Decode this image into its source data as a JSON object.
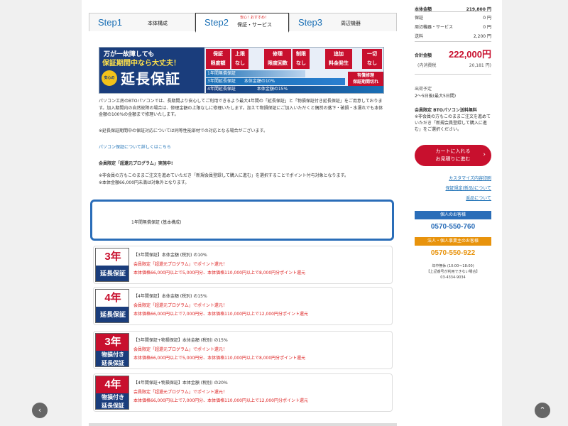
{
  "tabs": [
    {
      "num": "Step1",
      "name": "本体構成"
    },
    {
      "num": "Step2",
      "name": "保証・サービス",
      "sub": "安心！おすすめ！"
    },
    {
      "num": "Step3",
      "name": "周辺機器"
    }
  ],
  "banner": {
    "line1": "万が一故障しても",
    "line2": "保証期間中なら大丈夫！",
    "safe": "安心の",
    "main": "延長保証",
    "badges": [
      {
        "t1": "保証",
        "t2": "限度額"
      },
      {
        "t1": "上限",
        "t2": "なし"
      },
      {
        "t1": "修理",
        "t2": "限度回数"
      },
      {
        "t1": "制限",
        "t2": "なし"
      },
      {
        "t1": "追加",
        "t2": "料金発生"
      },
      {
        "t1": "一切",
        "t2": "なし"
      }
    ],
    "bars": [
      {
        "label": "1年間",
        "tag": "無償保証",
        "pct": ""
      },
      {
        "label": "3年間",
        "tag": "延長保証",
        "pct": "本体金額の10%"
      },
      {
        "label": "4年間",
        "tag": "延長保証",
        "pct": "本体金額の15%"
      }
    ],
    "end1": "有償修理",
    "end2": "保証期間切れ"
  },
  "content": {
    "p1": "パソコン工房のBTOパソコンでは、長期間より安心してご利用できるよう最大4年間の「延長保証」と「物損保証付き延長保証」をご用意しております。加入期間内の自然故障の場合は、修理金額の上限なしに修理いたします。加えて物損保証にご加入いただくと偶然の落下・破損・水濡れでも本体金額の100%の金額まで修理いたします。",
    "p2": "※延長保証期間中の保証対応については同等性能部材での対応となる場合がございます。",
    "link": "パソコン保証について詳しくはこちら",
    "h1": "会員限定「超還元プログラム」実施中!",
    "p3": "※非会員の方もこのままご注文を進めていただき「新規会員登録して購入に進む」を選択することでポイント付与対象となります。",
    "p4": "※本体金額66,000円未満は対象外となります。"
  },
  "options": {
    "selected": "1年間無償保証 (基本構成)",
    "items": [
      {
        "img_top": "3年",
        "img_bot": "延長保証",
        "title": "【3年間保証】本体金額 (税別) の10%",
        "l2": "会員限定「超還元プログラム」でポイント還元！",
        "l3": "本体価格66,000円以上で5,000円分、本体価格110,000円以上で8,000円分ポイント還元"
      },
      {
        "img_top": "4年",
        "img_bot": "延長保証",
        "title": "【4年間保証】本体金額 (税別) の15%",
        "l2": "会員限定「超還元プログラム」でポイント還元！",
        "l3": "本体価格66,000円以上で7,000円分、本体価格110,000円以上で12,000円分ポイント還元"
      },
      {
        "img_top": "3年",
        "img_bot1": "物損付き",
        "img_bot2": "延長保証",
        "title": "【3年間保証+物損保証】本体金額 (税別) の15%",
        "l2": "会員限定「超還元プログラム」でポイント還元！",
        "l3": "本体価格66,000円以上で5,000円分、本体価格110,000円以上で8,000円分ポイント還元"
      },
      {
        "img_top": "4年",
        "img_bot1": "物損付き",
        "img_bot2": "延長保証",
        "title": "【4年間保証+物損保証】本体金額 (税別) の20%",
        "l2": "会員限定「超還元プログラム」でポイント還元！",
        "l3": "本体価格66,000円以上で7,000円分、本体価格110,000円以上で12,000円分ポイント還元"
      }
    ]
  },
  "sidebar": {
    "rows": [
      {
        "k": "本体金額",
        "v": "219,800 円"
      },
      {
        "k": "保証",
        "v": "0 円"
      },
      {
        "k": "周辺機器・サービス",
        "v": "0 円"
      },
      {
        "k": "送料",
        "v": "2,200 円"
      }
    ],
    "total_label": "合計金額",
    "total_value": "222,000円",
    "tax_label": "(内消費税",
    "tax_value": "20,181 円)",
    "ship_label": "出荷予定",
    "ship_value": "2～5日後(最大5日間)",
    "free_title": "会員限定 BTOパソコン送料無料",
    "free_text": "※非会員の方もこのままご注文を進めていただき「新規会員登録して購入に進む」をご選択ください。",
    "cart_line1": "カートに入れる",
    "cart_line2": "お見積りに進む",
    "links": [
      "カスタマイズ内容印刷",
      "保証規定(新品)について",
      "返品について"
    ],
    "contact1_head": "個人のお客様",
    "contact1_num": "0570-550-760",
    "contact2_head": "法人・個人事業主のお客様",
    "contact2_num": "0570-550-922",
    "hours1": "年中無休 (10:00～18:00)",
    "hours2": "【上記番号が利用できない場合】",
    "hours3": "03-4334-9034"
  },
  "colors": {
    "accent": "#1a6fb5",
    "brand_red": "#c8102e",
    "navy": "#1a3d7c"
  },
  "nav": {
    "prev": "‹",
    "top": "⌃"
  }
}
